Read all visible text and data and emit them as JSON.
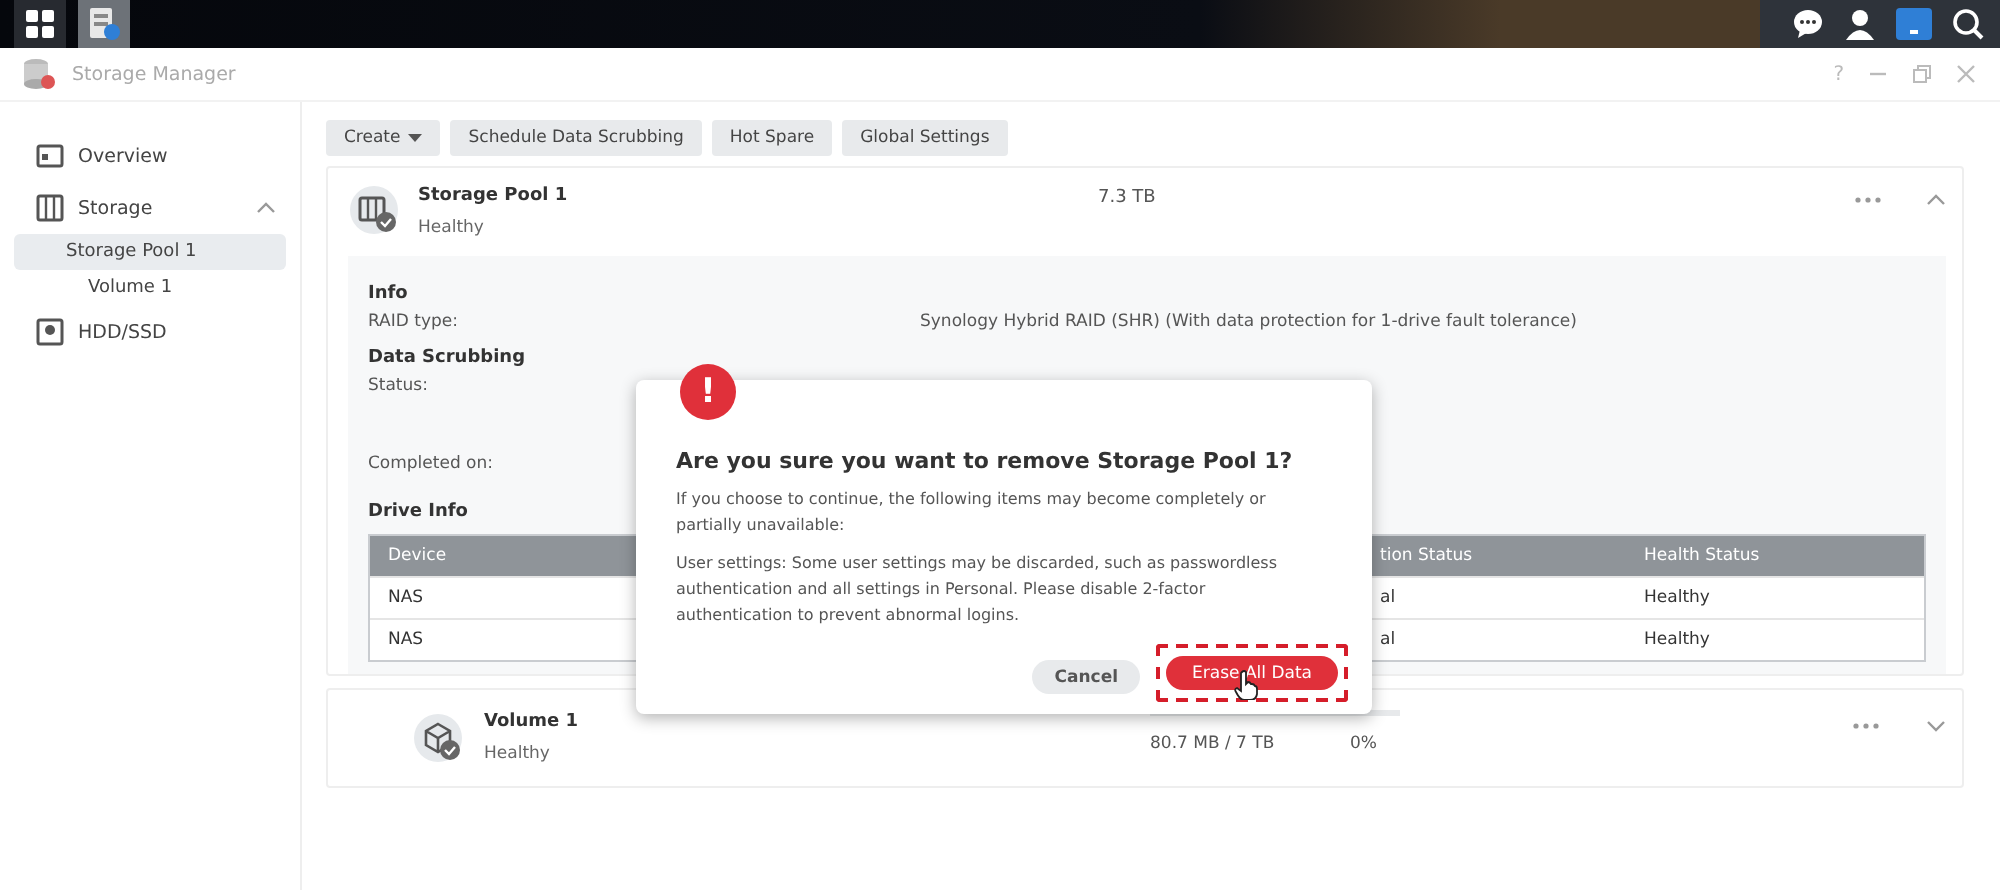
{
  "window": {
    "title": "Storage Manager",
    "help": "?"
  },
  "sidebar": {
    "items": [
      {
        "label": "Overview",
        "selected": false
      },
      {
        "label": "Storage",
        "selected": false,
        "expanded": true,
        "children": [
          {
            "label": "Storage Pool 1",
            "selected": true,
            "children": [
              {
                "label": "Volume 1",
                "selected": false
              }
            ]
          }
        ]
      },
      {
        "label": "HDD/SSD",
        "selected": false
      }
    ]
  },
  "toolbar": [
    {
      "label": "Create",
      "dropdown": true
    },
    {
      "label": "Schedule Data Scrubbing",
      "dropdown": false
    },
    {
      "label": "Hot Spare",
      "dropdown": false
    },
    {
      "label": "Global Settings",
      "dropdown": false
    }
  ],
  "pool": {
    "name": "Storage Pool 1",
    "status": "Healthy",
    "size": "7.3 TB",
    "expanded": true,
    "info_title": "Info",
    "raid_label": "RAID type:",
    "raid_value": "Synology Hybrid RAID (SHR) (With data protection for 1-drive fault tolerance)",
    "scrub_title": "Data Scrubbing",
    "scrub_status_label": "Status:",
    "completed_label": "Completed on:",
    "drive_title": "Drive Info",
    "table": {
      "columns": [
        "Device",
        "tion Status",
        "Health Status"
      ],
      "rows": [
        [
          "NAS",
          "al",
          "Healthy"
        ],
        [
          "NAS",
          "al",
          "Healthy"
        ]
      ]
    }
  },
  "volume": {
    "name": "Volume 1",
    "status": "Healthy",
    "usage": "80.7 MB / 7 TB",
    "percent": "0%",
    "level": 0,
    "expanded": false
  },
  "dialog": {
    "title": "Are you sure you want to remove Storage Pool 1?",
    "icon": "!",
    "paragraphs": [
      "If you choose to continue, the following items may become completely or partially unavailable:",
      "User settings: Some user settings may be discarded, such as passwordless authentication and all settings in Personal. Please disable 2-factor authentication to prevent abnormal logins."
    ],
    "buttons": [
      {
        "label": "Cancel",
        "kind": "secondary"
      },
      {
        "label": "Erase All Data",
        "kind": "danger"
      }
    ]
  }
}
